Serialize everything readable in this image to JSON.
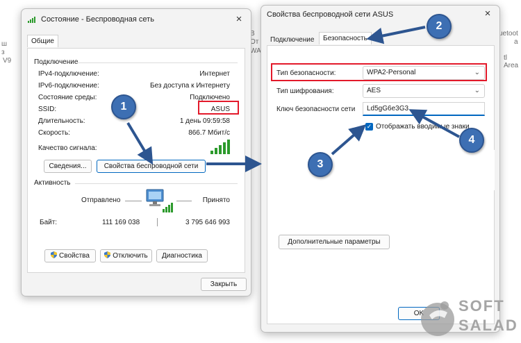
{
  "background": {
    "left_fragments": [
      "ш",
      "з",
      "V9"
    ],
    "right_fragments": [
      "uetoot",
      "tl Area",
      "a"
    ],
    "mid_fragments": [
      "В",
      "От",
      "WA"
    ]
  },
  "status_window": {
    "title": "Состояние - Беспроводная сеть",
    "tab": "Общие",
    "connection_group": "Подключение",
    "rows": [
      {
        "label": "IPv4-подключение:",
        "value": "Интернет"
      },
      {
        "label": "IPv6-подключение:",
        "value": "Без доступа к Интернету"
      },
      {
        "label": "Состояние среды:",
        "value": "Подключено"
      },
      {
        "label": "SSID:",
        "value": "ASUS"
      },
      {
        "label": "Длительность:",
        "value": "1 день 09:59:58"
      },
      {
        "label": "Скорость:",
        "value": "866.7 Мбит/с"
      }
    ],
    "signal_label": "Качество сигнала:",
    "details_button": "Сведения...",
    "wireless_props_button": "Свойства беспроводной сети",
    "activity_group": "Активность",
    "sent_label": "Отправлено",
    "received_label": "Принято",
    "bytes_label": "Байт:",
    "bytes_sent": "111 169 038",
    "bytes_received": "3 795 646 993",
    "properties_button": "Свойства",
    "disconnect_button": "Отключить",
    "diagnose_button": "Диагностика",
    "close_button": "Закрыть"
  },
  "props_window": {
    "title": "Свойства беспроводной сети ASUS",
    "tab_connection": "Подключение",
    "tab_security": "Безопасность",
    "security_type_label": "Тип безопасности:",
    "security_type_value": "WPA2-Personal",
    "encryption_label": "Тип шифрования:",
    "encryption_value": "AES",
    "key_label": "Ключ безопасности сети",
    "key_value": "Ld5gG6e3G3",
    "show_chars_label": "Отображать вводимые знаки",
    "advanced_button": "Дополнительные параметры",
    "ok_button": "OK"
  },
  "callouts": [
    "1",
    "2",
    "3",
    "4"
  ],
  "watermark": {
    "line1": "SOFT",
    "line2": "SALAD"
  },
  "colors": {
    "accent": "#0067c0",
    "callout": "#3d6fb3",
    "highlight": "#e3192a",
    "signal": "#2c9a2c"
  }
}
